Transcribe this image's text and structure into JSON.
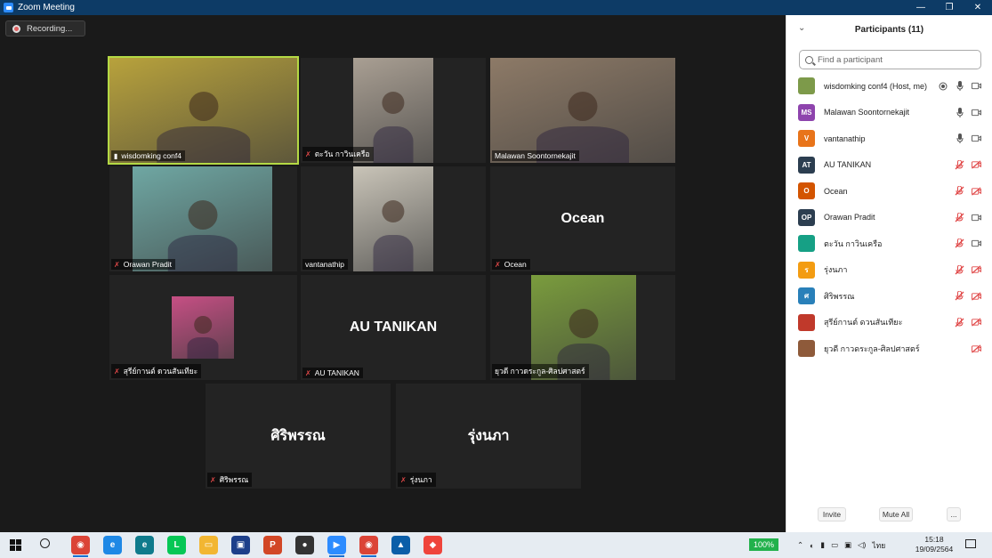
{
  "window": {
    "title": "Zoom Meeting",
    "minimize": "—",
    "restore": "❐",
    "close": "✕"
  },
  "recording": {
    "label": "Recording..."
  },
  "tiles": [
    {
      "name": "wisdomking conf4",
      "muted": false,
      "active": true,
      "video": true,
      "bg": "#b8a23c"
    },
    {
      "name": "ตะวัน กาวินเครือ",
      "muted": true,
      "video": true,
      "bg": "#a99f93"
    },
    {
      "name": "Malawan Soontornekajit",
      "muted": false,
      "video": true,
      "bg": "#8d7a67"
    },
    {
      "name": "Orawan Pradit",
      "muted": true,
      "video": true,
      "bg": "#6fa7a3"
    },
    {
      "name": "vantanathip",
      "muted": false,
      "video": true,
      "bg": "#c9c4b8"
    },
    {
      "name": "Ocean",
      "muted": true,
      "video": false,
      "big": "Ocean"
    },
    {
      "name": "สุรีย์กานต์ ดวนสันเทียะ",
      "muted": true,
      "video": true,
      "bg": "#c64f84"
    },
    {
      "name": "AU TANIKAN",
      "muted": true,
      "video": false,
      "big": "AU TANIKAN"
    },
    {
      "name": "ยุวดี กาวดระกูล-ศิลปศาสตร์",
      "muted": false,
      "video": true,
      "bg": "#7a9c3d"
    },
    {
      "name": "ศิริพรรณ",
      "muted": true,
      "video": false,
      "big": "ศิริพรรณ"
    },
    {
      "name": "รุ่งนภา",
      "muted": true,
      "video": false,
      "big": "รุ่งนภา"
    }
  ],
  "panel": {
    "title": "Participants (11)",
    "search_placeholder": "Find a participant",
    "participants": [
      {
        "name": "wisdomking conf4 (Host, me)",
        "initials": "",
        "color": "#7d9a4a",
        "mic": "on",
        "cam": "on",
        "rec": true
      },
      {
        "name": "Malawan Soontornekajit",
        "initials": "MS",
        "color": "#8e44ad",
        "mic": "on",
        "cam": "on"
      },
      {
        "name": "vantanathip",
        "initials": "V",
        "color": "#e8741a",
        "mic": "on",
        "cam": "on"
      },
      {
        "name": "AU TANIKAN",
        "initials": "AT",
        "color": "#2c3e50",
        "mic": "off",
        "cam": "off"
      },
      {
        "name": "Ocean",
        "initials": "O",
        "color": "#d35400",
        "mic": "off",
        "cam": "off"
      },
      {
        "name": "Orawan Pradit",
        "initials": "OP",
        "color": "#2c3e50",
        "mic": "off",
        "cam": "on"
      },
      {
        "name": "ตะวัน กาวินเครือ",
        "initials": "",
        "color": "#16a085",
        "mic": "off",
        "cam": "on"
      },
      {
        "name": "รุ่งนภา",
        "initials": "ร",
        "color": "#f39c12",
        "mic": "off",
        "cam": "off"
      },
      {
        "name": "ศิริพรรณ",
        "initials": "ศ",
        "color": "#2980b9",
        "mic": "off",
        "cam": "off"
      },
      {
        "name": "สุรีย์กานต์ ดวนสันเทียะ",
        "initials": "",
        "color": "#c0392b",
        "mic": "off",
        "cam": "off"
      },
      {
        "name": "ยุวดี กาวดระกูล-ศิลปศาสตร์",
        "initials": "",
        "color": "#8e5a3a",
        "mic": "",
        "cam": "off"
      }
    ],
    "invite": "Invite",
    "mute_all": "Mute All",
    "more": "..."
  },
  "taskbar": {
    "battery": "100%",
    "lang": "ไทย",
    "time": "15:18",
    "date": "19/09/2564",
    "apps": [
      {
        "name": "chrome",
        "color": "#db4437",
        "glyph": "◉"
      },
      {
        "name": "ie",
        "color": "#1e88e5",
        "glyph": "e"
      },
      {
        "name": "edge",
        "color": "#0f7b8c",
        "glyph": "e"
      },
      {
        "name": "line",
        "color": "#06c755",
        "glyph": "L"
      },
      {
        "name": "explorer",
        "color": "#f2b632",
        "glyph": "▭"
      },
      {
        "name": "screen-recorder",
        "color": "#1d3f8a",
        "glyph": "▣"
      },
      {
        "name": "powerpoint",
        "color": "#d24726",
        "glyph": "P"
      },
      {
        "name": "obs",
        "color": "#333333",
        "glyph": "●"
      },
      {
        "name": "zoom",
        "color": "#2d8cff",
        "glyph": "▶"
      },
      {
        "name": "chrome-2",
        "color": "#db4437",
        "glyph": "◉"
      },
      {
        "name": "photos",
        "color": "#0a5ea8",
        "glyph": "▲"
      },
      {
        "name": "anydesk",
        "color": "#ef443b",
        "glyph": "◆"
      }
    ]
  }
}
